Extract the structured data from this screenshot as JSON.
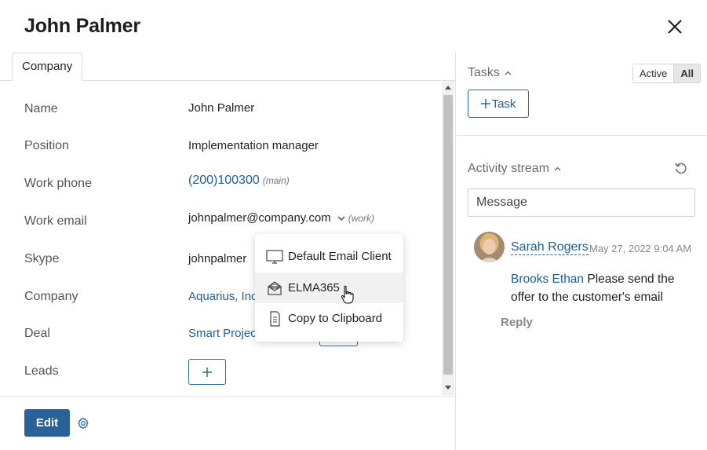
{
  "header": {
    "title": "John Palmer"
  },
  "tabs": [
    {
      "label": "Company"
    }
  ],
  "fields": {
    "name": {
      "label": "Name",
      "value": "John Palmer"
    },
    "position": {
      "label": "Position",
      "value": "Implementation manager"
    },
    "work_phone": {
      "label": "Work phone",
      "value": "(200)100300",
      "tag": "(main)"
    },
    "work_email": {
      "label": "Work email",
      "value": "johnpalmer@company.com",
      "tag": "(work)"
    },
    "skype": {
      "label": "Skype",
      "value": "johnpalmer"
    },
    "company": {
      "label": "Company",
      "value": "Aquarius, Inc."
    },
    "deal": {
      "label": "Deal",
      "value": "Smart Project"
    },
    "leads": {
      "label": "Leads"
    }
  },
  "email_menu": {
    "items": [
      {
        "label": "Default Email Client",
        "icon": "monitor-icon"
      },
      {
        "label": "ELMA365",
        "icon": "envelope-icon"
      },
      {
        "label": "Copy to Clipboard",
        "icon": "document-icon"
      }
    ]
  },
  "footer": {
    "edit_label": "Edit"
  },
  "tasks": {
    "title": "Tasks",
    "filter_active": "Active",
    "filter_all": "All",
    "add_label": "Task"
  },
  "activity": {
    "title": "Activity stream",
    "message_placeholder": "Message",
    "posts": [
      {
        "author": "Sarah Rogers",
        "date": "May 27, 2022 9:04 AM",
        "mention": "Brooks Ethan",
        "text": " Please send the offer to the customer's email",
        "reply_label": "Reply"
      }
    ]
  },
  "colors": {
    "link": "#1f5e95",
    "primary_button": "#2a6196",
    "label": "#555555"
  }
}
